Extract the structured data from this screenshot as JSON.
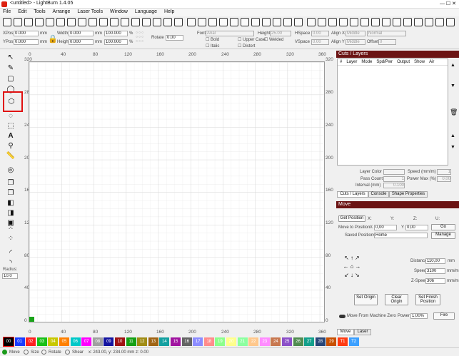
{
  "window": {
    "title": "<untitled> - LightBurn 1.4.05"
  },
  "menu": [
    "File",
    "Edit",
    "Tools",
    "Arrange",
    "Laser Tools",
    "Window",
    "Language",
    "Help"
  ],
  "props": {
    "xpos_label": "XPos",
    "xpos_value": "0.000",
    "ypos_label": "YPos",
    "ypos_value": "0.000",
    "mm": "mm",
    "width_label": "Width",
    "width_value": "0.000",
    "height_label": "Height",
    "height_value": "0.000",
    "pct_w": "100.000",
    "pct_h": "100.000",
    "pct": "%",
    "rotate_label": "Rotate",
    "rotate_value": "0.00"
  },
  "text_props": {
    "font_label": "Font",
    "font_value": "Arial",
    "height_label": "Height",
    "height_value": "25.00",
    "bold": "Bold",
    "italic": "Italic",
    "upper_case": "Upper Case",
    "welded": "Welded",
    "distort": "Distort",
    "hspace_label": "HSpace",
    "hspace_value": "0.00",
    "vspace_label": "VSpace",
    "vspace_value": "0.00",
    "alignx_label": "Align X",
    "alignx_value": "Middle",
    "aligny_label": "Align Y",
    "aligny_value": "Middle",
    "normal": "Normal",
    "offset_label": "Offset",
    "offset_value": "0"
  },
  "ruler_x": [
    "0",
    "40",
    "80",
    "120",
    "160",
    "200",
    "240",
    "280",
    "320",
    "360"
  ],
  "ruler_y": [
    "320",
    "280",
    "240",
    "200",
    "160",
    "120",
    "80",
    "40",
    "0"
  ],
  "radius": {
    "label": "Radius:",
    "value": "10.0"
  },
  "cuts": {
    "title": "Cuts / Layers",
    "columns": [
      "#",
      "Layer",
      "Mode",
      "Spd/Pwr",
      "Output",
      "Show",
      "Air"
    ],
    "layer_color": "Layer Color",
    "speed_label": "Speed (mm/m)",
    "speed_value": "1",
    "pass_count": "Pass Count",
    "pass_value": "1",
    "power_max_label": "Power Max (%)",
    "power_max_value": "0,00",
    "interval_label": "Interval (mm)",
    "interval_value": "0.100",
    "tabs": [
      "Cuts / Layers",
      "Console",
      "Shape Properties"
    ]
  },
  "move": {
    "title": "Move",
    "get_position": "Get Position",
    "x": "X:",
    "y": "Y:",
    "z": "Z:",
    "u": "U:",
    "move_to_position": "Move to Position",
    "mx": "X",
    "mx_val": "0,00",
    "my": "Y",
    "my_val": "0,00",
    "go": "Go",
    "saved_positions": "Saved Positions:",
    "saved_value": "Home",
    "manage": "Manage",
    "distance_label": "Distance",
    "distance_value": "110,00",
    "speed_label": "Speed",
    "speed_value": "3100",
    "zspeed_label": "Z-Speed",
    "zspeed_value": "306",
    "mm": "mm",
    "mmm": "mm/m",
    "set_origin": "Set Origin",
    "clear_origin": "Clear Origin",
    "set_finish": "Set Finish Position",
    "move_from_zero": "Move From Machine Zero",
    "power_label": "Power",
    "power_value": "1,00%",
    "fire": "Fire",
    "tabs": [
      "Move",
      "Laser"
    ]
  },
  "palette": [
    {
      "label": "00",
      "color": "#000000"
    },
    {
      "label": "01",
      "color": "#1a3cff"
    },
    {
      "label": "02",
      "color": "#ff2020"
    },
    {
      "label": "03",
      "color": "#18c018"
    },
    {
      "label": "04",
      "color": "#c8c800"
    },
    {
      "label": "05",
      "color": "#ff8000"
    },
    {
      "label": "06",
      "color": "#00c8c8"
    },
    {
      "label": "07",
      "color": "#ff00ff"
    },
    {
      "label": "08",
      "color": "#a0a0a0"
    },
    {
      "label": "09",
      "color": "#1414a0"
    },
    {
      "label": "10",
      "color": "#a01414"
    },
    {
      "label": "11",
      "color": "#14a014"
    },
    {
      "label": "12",
      "color": "#a08c14"
    },
    {
      "label": "13",
      "color": "#a06414"
    },
    {
      "label": "14",
      "color": "#14a0a0"
    },
    {
      "label": "15",
      "color": "#a014a0"
    },
    {
      "label": "16",
      "color": "#646464"
    },
    {
      "label": "17",
      "color": "#8c8cff"
    },
    {
      "label": "18",
      "color": "#ff8c8c"
    },
    {
      "label": "19",
      "color": "#8cff8c"
    },
    {
      "label": "20",
      "color": "#ffff8c"
    },
    {
      "label": "21",
      "color": "#8cffa0"
    },
    {
      "label": "22",
      "color": "#ffc88c"
    },
    {
      "label": "23",
      "color": "#ff8cff"
    },
    {
      "label": "24",
      "color": "#c87850"
    },
    {
      "label": "25",
      "color": "#8c50c8"
    },
    {
      "label": "26",
      "color": "#508c50"
    },
    {
      "label": "27",
      "color": "#14a08c"
    },
    {
      "label": "28",
      "color": "#284678"
    },
    {
      "label": "29",
      "color": "#c85000"
    },
    {
      "label": "T1",
      "color": "#ff3c14"
    },
    {
      "label": "T2",
      "color": "#3ca0ff"
    }
  ],
  "status": {
    "move": "Move",
    "size": "Size",
    "rotate": "Rotate",
    "shear": "Shear",
    "coords": "x: 243.00, y: 234.00 mm  z: 0.00"
  }
}
